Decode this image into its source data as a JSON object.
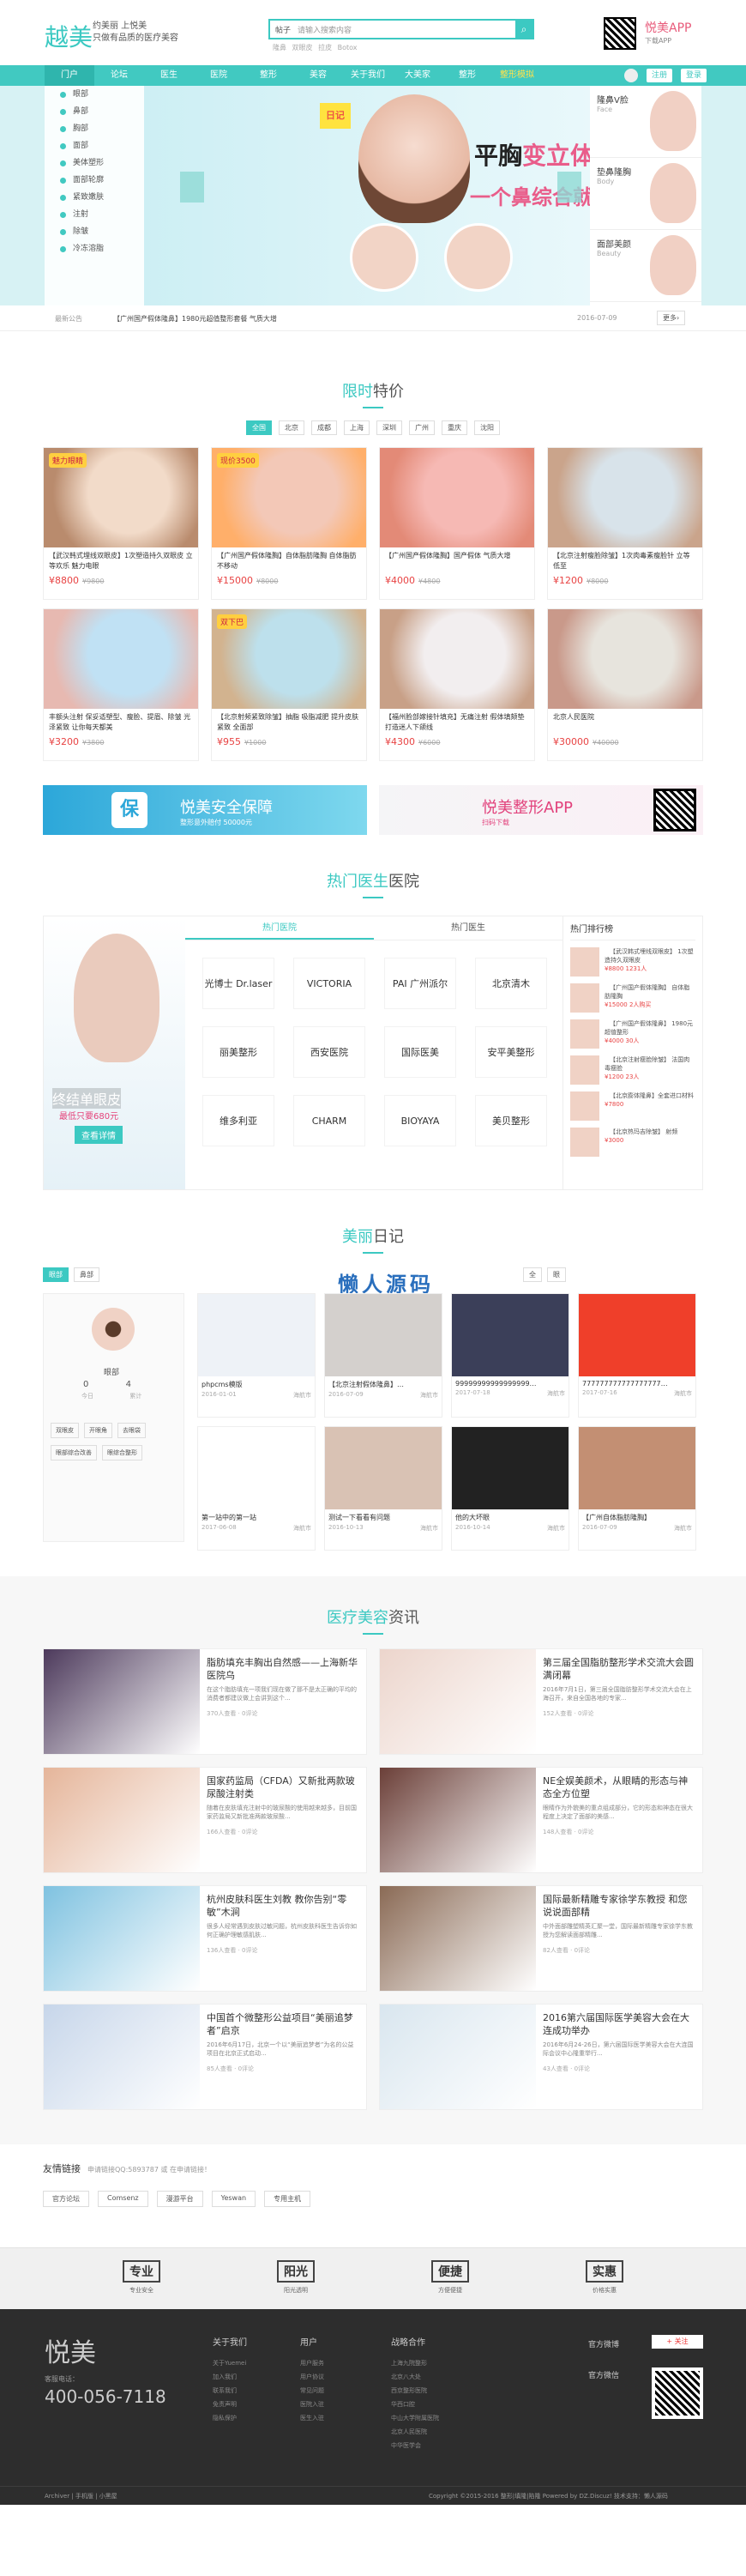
{
  "header": {
    "logo": "越美",
    "slogan1": "约美丽 上悦美",
    "slogan2": "只做有品质的医疗美容",
    "search_cat": "帖子",
    "search_placeholder": "请输入搜索内容",
    "hotwords": "隆鼻 双眼皮 拉皮 Botox",
    "app": "悦美APP",
    "app_sub": "下载APP"
  },
  "nav": {
    "items": [
      "门户",
      "论坛",
      "医生",
      "医院",
      "整形",
      "美容",
      "关于我们",
      "大美家",
      "整形",
      "整形模拟"
    ],
    "register": "注册",
    "login": "登录"
  },
  "banner": {
    "menu": [
      "眼部",
      "鼻部",
      "胸部",
      "面部",
      "美体塑形",
      "面部轮廓",
      "紧致嫩肤",
      "注射",
      "除皱",
      "冷冻溶脂"
    ],
    "title_a": "平胸",
    "title_b": "变立体",
    "subtitle": "一个鼻综合就够了",
    "diary": "日记",
    "right": [
      {
        "t": "隆鼻V脸",
        "s": "Face"
      },
      {
        "t": "垫鼻隆胸",
        "s": "Body"
      },
      {
        "t": "面部美颜",
        "s": "Beauty"
      }
    ]
  },
  "notice": {
    "label": "最新公告",
    "text": "【广州国产假体隆鼻】1980元超值整形套餐 气质大增",
    "date": "2016-07-09",
    "more": "更多›"
  },
  "special": {
    "title_a": "限时",
    "title_b": "特价",
    "cities": [
      "全国",
      "北京",
      "成都",
      "上海",
      "深圳",
      "广州",
      "重庆",
      "沈阳"
    ],
    "items": [
      {
        "badge": "魅力眼睛",
        "desc": "【武汉韩式埋线双眼皮】1次塑造持久双眼皮 立等欢乐 魅力电眼",
        "price": "¥8800",
        "old": "¥9800",
        "c1": "#f2dbc9",
        "c2": "#b98b6d"
      },
      {
        "badge": "现价3500",
        "desc": "【广州国产假体隆胸】自体脂肪隆胸 自体脂肪不移动",
        "price": "¥15000",
        "old": "¥8000",
        "c1": "#f3c8b7",
        "c2": "#ffaf6a"
      },
      {
        "badge": "",
        "desc": "【广州国产假体隆胸】国产假体 气质大增",
        "price": "¥4000",
        "old": "¥4800",
        "c1": "#f6b9b4",
        "c2": "#e38a77"
      },
      {
        "badge": "",
        "desc": "【北京注射瘦脸除皱】1次肉毒素瘦脸针 立等 低至",
        "price": "¥1200",
        "old": "¥8000",
        "c1": "#d8e3ea",
        "c2": "#caa48b"
      },
      {
        "badge": "",
        "desc": "丰额头注射 保妥适塑型、瘦脸、提眉、除皱 光泽紧致 让你每天都美",
        "price": "¥3200",
        "old": "¥3800",
        "c1": "#c0e1f4",
        "c2": "#e7b9b1"
      },
      {
        "badge": "双下巴",
        "desc": "【北京射频紧致除皱】抽脂 吸脂减肥 提升皮肤紧致 全面部",
        "price": "¥955",
        "old": "¥1000",
        "c1": "#bde0ec",
        "c2": "#d2b38f"
      },
      {
        "badge": "",
        "desc": "【福州脸部嫁接针填充】无痛注射 假体填颏垫 打造迷人下颌线",
        "price": "¥4300",
        "old": "¥6000",
        "c1": "#f2eeef",
        "c2": "#c8a087"
      },
      {
        "badge": "",
        "desc": "北京人民医院",
        "price": "¥30000",
        "old": "¥40000",
        "c1": "#e7e4dd",
        "c2": "#c9998a"
      }
    ]
  },
  "promos": {
    "b1_big": "悦美安全保障",
    "b1_sm": "整形意外赔付 50000元",
    "b1_icon": "保",
    "b2_big": "悦美整形APP",
    "b2_sm": "扫码下载"
  },
  "hospital": {
    "title_a": "热门医生",
    "title_b": "医院",
    "tabs": [
      "热门医院",
      "热门医生"
    ],
    "ad_big": "终结单眼皮",
    "ad_sm": "最低只要680元",
    "ad_btn": "查看详情",
    "logos": [
      "光博士 Dr.laser",
      "VICTORIA",
      "PAI 广州派尔",
      "北京清木",
      "丽美整形",
      "西安医院",
      "国际医美",
      "安平美整形",
      "维多利亚",
      "CHARM",
      "BIOYAYA",
      "美贝整形"
    ],
    "rank_title": "热门排行榜",
    "ranks": [
      {
        "t": "【武汉韩式埋线双眼皮】 1次塑造持久双眼皮",
        "p": "¥8800 1231人"
      },
      {
        "t": "【广州国产假体隆胸】 自体脂肪隆胸",
        "p": "¥15000 2人购买"
      },
      {
        "t": "【广州国产假体隆鼻】 1980元超值整形",
        "p": "¥4000 30人"
      },
      {
        "t": "【北京注射瘦脸除皱】 法国肉毒瘦脸",
        "p": "¥1200 23人"
      },
      {
        "t": "【北京膨体隆鼻】全套进口材料",
        "p": "¥7800"
      },
      {
        "t": "【北京热玛吉除皱】 射频",
        "p": "¥3000"
      }
    ]
  },
  "diary": {
    "title_a": "美丽",
    "title_b": "日记",
    "tabs": [
      "眼部",
      "鼻部"
    ],
    "tabs2": [
      "全",
      "眼"
    ],
    "wm1": "懒人源码",
    "wm2": "lanrenzhijia.com",
    "profile": {
      "name": "眼部",
      "n1": "0",
      "n2": "4",
      "l1": "今日",
      "l2": "累计",
      "tags": [
        "双眼皮",
        "开眼角",
        "去眼袋",
        "眼部综合改善",
        "眼综合整形"
      ]
    },
    "items": [
      {
        "t": "phpcms模版",
        "d": "2016-01-01",
        "u": "海航市",
        "c": "#eef2f7"
      },
      {
        "t": "【北京注射假体隆鼻】…",
        "d": "2016-07-09",
        "u": "海航市",
        "c": "#d4d0cd"
      },
      {
        "t": "99999999999999999…",
        "d": "2017-07-18",
        "u": "海航市",
        "c": "#3b3f59"
      },
      {
        "t": "777777777777777777…",
        "d": "2017-07-16",
        "u": "海航市",
        "c": "#ef3f2a"
      },
      {
        "t": "第一站中的第一站",
        "d": "2017-06-08",
        "u": "海航市",
        "c": "#ffffff"
      },
      {
        "t": "测试一下看看有问题",
        "d": "2016-10-13",
        "u": "海航市",
        "c": "#d9c2b4"
      },
      {
        "t": "他的大坏眼",
        "d": "2016-10-14",
        "u": "海航市",
        "c": "#222222"
      },
      {
        "t": "【广州自体脂肪隆胸】",
        "d": "2016-07-09",
        "u": "海航市",
        "c": "#c38f73"
      }
    ]
  },
  "news": {
    "title_a": "医疗美容",
    "title_b": "资讯",
    "items": [
      {
        "t": "脂肪填充丰胸出自然感——上海新华医院乌",
        "p": "在这个脂肪填充一项我们现在做了那不是太正确的平均的消费者都建议做上会讲到这个...",
        "m": "370人查看 · 0评论",
        "c": "#4d3a5c"
      },
      {
        "t": "第三届全国脂肪整形学术交流大会圆满闭幕",
        "p": "2016年7月1日，第三届全国脂肪整形学术交流大会在上海召开，来自全国各地的专家...",
        "m": "152人查看 · 0评论",
        "c": "#ecd5cc"
      },
      {
        "t": "国家药监局（CFDA）又新批两款玻尿酸注射类",
        "p": "随着在皮肤填充注射中的玻尿酸的使用越来越多，目前国家药监局又新批准两款玻尿酸...",
        "m": "166人查看 · 0评论",
        "c": "#e5b59a"
      },
      {
        "t": "NE全娱美颜术，从眼睛的形态与神态全方位塑",
        "p": "眼睛作为外貌美的重点组成部分，它的形态和神态在很大程度上决定了面部的美感...",
        "m": "148人查看 · 0评论",
        "c": "#6b3f38"
      },
      {
        "t": "杭州皮肤科医生刘教 教你告别“零敏”木涧",
        "p": "很多人经常遇到皮肤过敏问题，杭州皮肤科医生告诉你如何正确护理敏感肌肤...",
        "m": "136人查看 · 0评论",
        "c": "#7fc2e0"
      },
      {
        "t": "国际最新精雕专家徐学东教授 和您说说面部精",
        "p": "中外面部雕塑精英汇聚一堂，国际最新精雕专家徐学东教授为您解读面部精雕...",
        "m": "82人查看 · 0评论",
        "c": "#8a6a55"
      },
      {
        "t": "中国首个微整形公益项目“美丽追梦者”启京",
        "p": "2016年6月17日，北京一个以“美丽追梦者”为名的公益项目在北京正式启动...",
        "m": "85人查看 · 0评论",
        "c": "#c7d6ea"
      },
      {
        "t": "2016第六届国际医学美容大会在大连成功举办",
        "p": "2016年6月24-26日，第六届国际医学美容大会在大连国际会议中心隆重举行...",
        "m": "43人查看 · 0评论",
        "c": "#d9e6ef"
      }
    ]
  },
  "links": {
    "title": "友情链接",
    "note": "申请链接QQ:5893787 或 在申请链接！",
    "items": [
      "官方论坛",
      "Comsenz",
      "漫游平台",
      "Yeswan",
      "专用主机"
    ]
  },
  "promise": [
    {
      "t": "专业",
      "s": "专业安全"
    },
    {
      "t": "阳光",
      "s": "阳光透明"
    },
    {
      "t": "便捷",
      "s": "方便便捷"
    },
    {
      "t": "实惠",
      "s": "价格实惠"
    }
  ],
  "footer": {
    "logo": "悦美",
    "tel_label": "客服电话：",
    "tel": "400-056-7118",
    "cols": [
      {
        "t": "关于我们",
        "i": [
          "关于Yuemei",
          "加入我们",
          "联系我们",
          "免责声明",
          "隐私保护"
        ]
      },
      {
        "t": "用户",
        "i": [
          "用户服务",
          "用户协议",
          "常见问题",
          "医院入驻",
          "医生入驻"
        ]
      },
      {
        "t": "战略合作",
        "i": [
          "上海九院整形",
          "北京八大处",
          "西京整形医院",
          "华西口腔",
          "中山大学附属医院",
          "北京人民医院",
          "中华医学会"
        ]
      }
    ],
    "weibo": "官方微博",
    "weixin": "官方微信",
    "weibo_btn": "+ 关注",
    "copy_l": "Archiver | 手机版 | 小黑屋",
    "copy_r": "Copyright  ©2015-2016  整形|填隆|陷隆  Powered by DZ.Discuz!  技术支持：懒人源码"
  }
}
